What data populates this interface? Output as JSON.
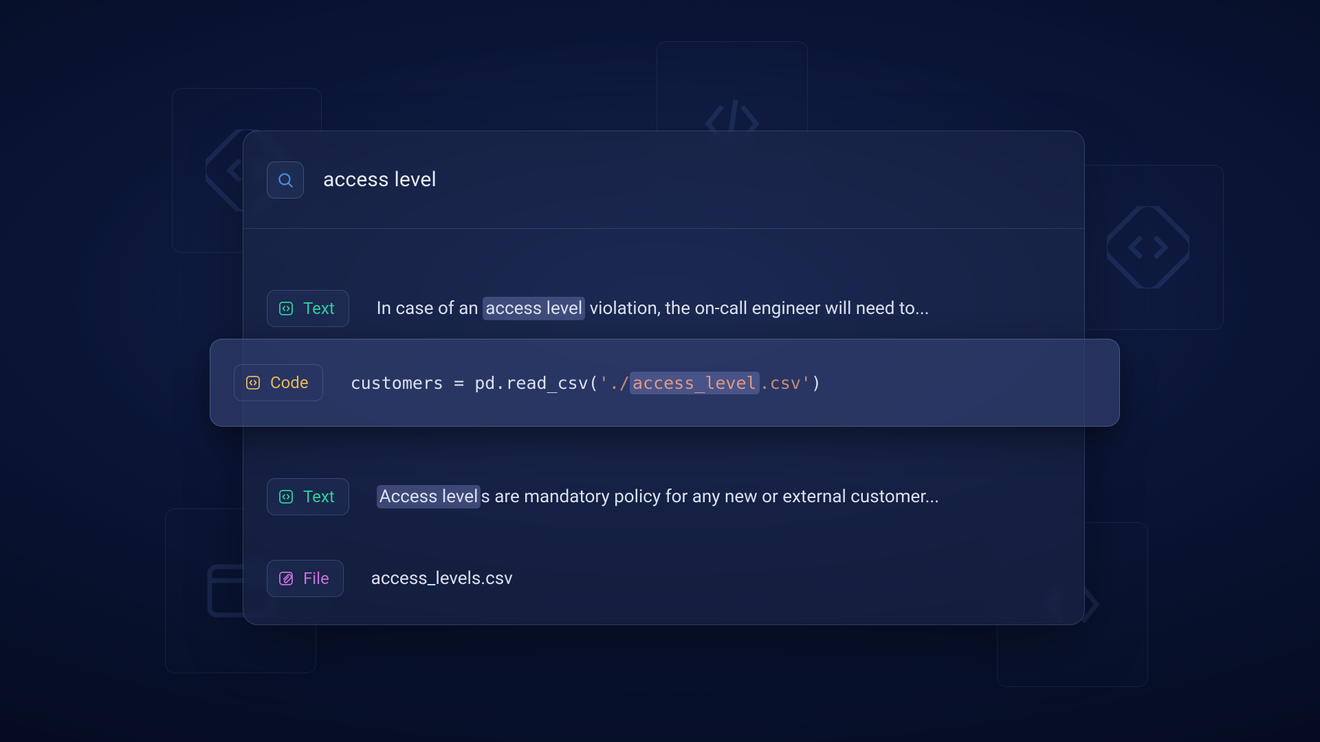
{
  "search": {
    "query": "access level"
  },
  "badges": {
    "text": "Text",
    "code": "Code",
    "file": "File"
  },
  "results": [
    {
      "type": "text",
      "pre": "In case of an ",
      "highlight": "access level",
      "post": " violation, the on-call engineer will need to..."
    },
    {
      "type": "code",
      "selected": true,
      "code_pre": "customers = pd.read_csv(",
      "code_str_pre": "'./",
      "code_highlight": "access_level",
      "code_str_post": ".csv'",
      "code_post": ")"
    },
    {
      "type": "text",
      "pre": "",
      "highlight": "Access level",
      "post": "s are mandatory policy for any new or external customer..."
    },
    {
      "type": "file",
      "filename": "access_levels.csv"
    }
  ],
  "colors": {
    "text_badge": "#2ecf9b",
    "code_badge": "#e7b85a",
    "file_badge": "#c96fd9",
    "highlight_bg": "#6e78b4"
  }
}
